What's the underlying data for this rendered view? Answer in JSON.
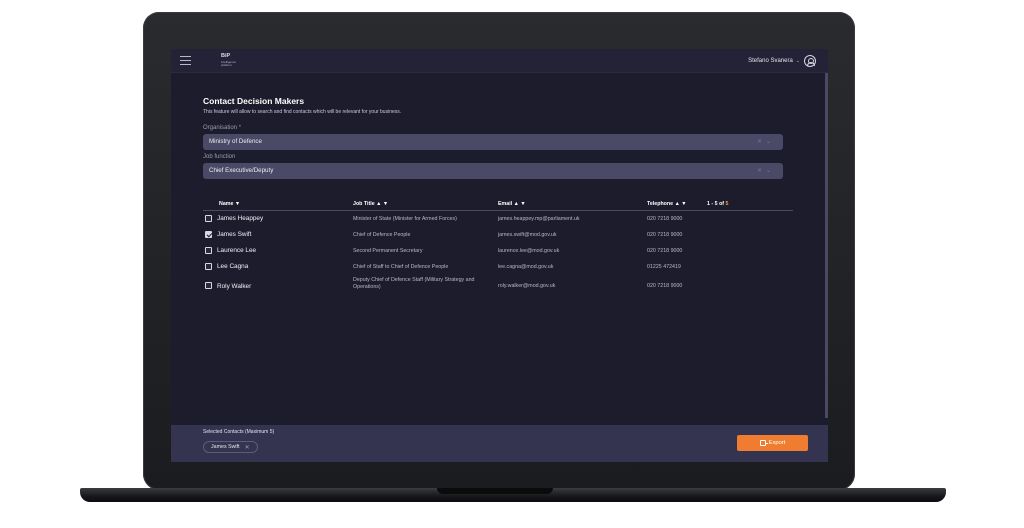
{
  "app": {
    "logo_title": "BiP",
    "logo_subtitle_1": "intelligence",
    "logo_subtitle_2": "platform",
    "user_name": "Stefano Svanera"
  },
  "page": {
    "title": "Contact Decision Makers",
    "description": "This feature will allow to search and find contacts which will be relevant for your business."
  },
  "filters": {
    "organisation_label": "Organisation",
    "organisation_required_mark": "*",
    "organisation_value": "Ministry of Defence",
    "job_function_label": "Job function",
    "job_function_value": "Chief Executive/Deputy"
  },
  "table": {
    "headers": {
      "name": "Name ▼",
      "job_title": "Job Title ▲ ▼",
      "email": "Email ▲ ▼",
      "telephone": "Telephone ▲ ▼"
    },
    "pager": {
      "range": "1 - 5 of ",
      "total": "5"
    },
    "rows": [
      {
        "checked": false,
        "name": "James Heappey",
        "job_title": "Minister of State (Minister for Armed Forces)",
        "email": "james.heappey.mp@parliament.uk",
        "telephone": "020 7218 9000"
      },
      {
        "checked": true,
        "name": "James Swift",
        "job_title": "Chief of Defence People",
        "email": "james.swift@mod.gov.uk",
        "telephone": "020 7218 9000"
      },
      {
        "checked": false,
        "name": "Laurence Lee",
        "job_title": "Second Permanent Secretary",
        "email": "laurence.lee@mod.gov.uk",
        "telephone": "020 7218 9000"
      },
      {
        "checked": false,
        "name": "Lee Cagna",
        "job_title": "Chief of Staff to Chief of Defence People",
        "email": "lee.cagna@mod.gov.uk",
        "telephone": "01225 472419"
      },
      {
        "checked": false,
        "name": "Roly Walker",
        "job_title": "Deputy Chief of Defence Staff (Military Strategy and Operations)",
        "email": "roly.walker@mod.gov.uk",
        "telephone": "020 7218 9000"
      }
    ]
  },
  "footer": {
    "selected_label": "Selected Contacts (Maximum 5)",
    "selected_chip": "James Swift",
    "export_label": "Export"
  },
  "colors": {
    "accent": "#f07d2f",
    "background": "#1d1c2d",
    "select_bg": "#4a4966",
    "footer_bg": "#343350"
  }
}
